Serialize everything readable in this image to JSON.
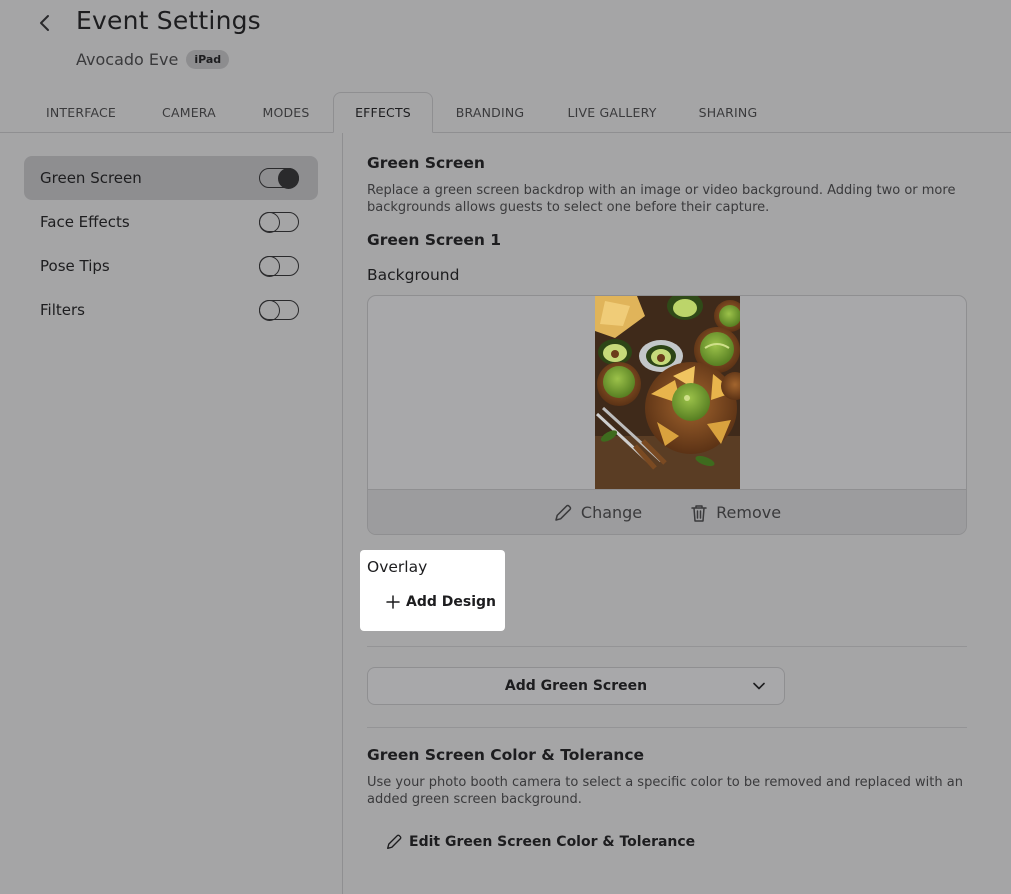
{
  "header": {
    "title": "Event Settings",
    "event_name": "Avocado Eve",
    "device_badge": "iPad"
  },
  "tabs": [
    {
      "label": "INTERFACE"
    },
    {
      "label": "CAMERA"
    },
    {
      "label": "MODES"
    },
    {
      "label": "EFFECTS",
      "active": true
    },
    {
      "label": "BRANDING"
    },
    {
      "label": "LIVE GALLERY"
    },
    {
      "label": "SHARING"
    }
  ],
  "sidebar": {
    "items": [
      {
        "label": "Green Screen",
        "enabled": true,
        "active": true
      },
      {
        "label": "Face Effects",
        "enabled": false
      },
      {
        "label": "Pose Tips",
        "enabled": false
      },
      {
        "label": "Filters",
        "enabled": false
      }
    ]
  },
  "main": {
    "section_title": "Green Screen",
    "section_desc": "Replace a green screen backdrop with an image or video background. Adding two or more backgrounds allows guests to select one before their capture.",
    "screen_title": "Green Screen 1",
    "background_label": "Background",
    "change_label": "Change",
    "remove_label": "Remove",
    "overlay_label": "Overlay",
    "add_design_label": "Add Design",
    "add_green_screen_label": "Add Green Screen",
    "color_section_title": "Green Screen Color & Tolerance",
    "color_section_desc": "Use your photo booth camera to select a specific color to be removed and replaced with an added green screen background.",
    "edit_color_label": "Edit Green Screen Color & Tolerance"
  }
}
